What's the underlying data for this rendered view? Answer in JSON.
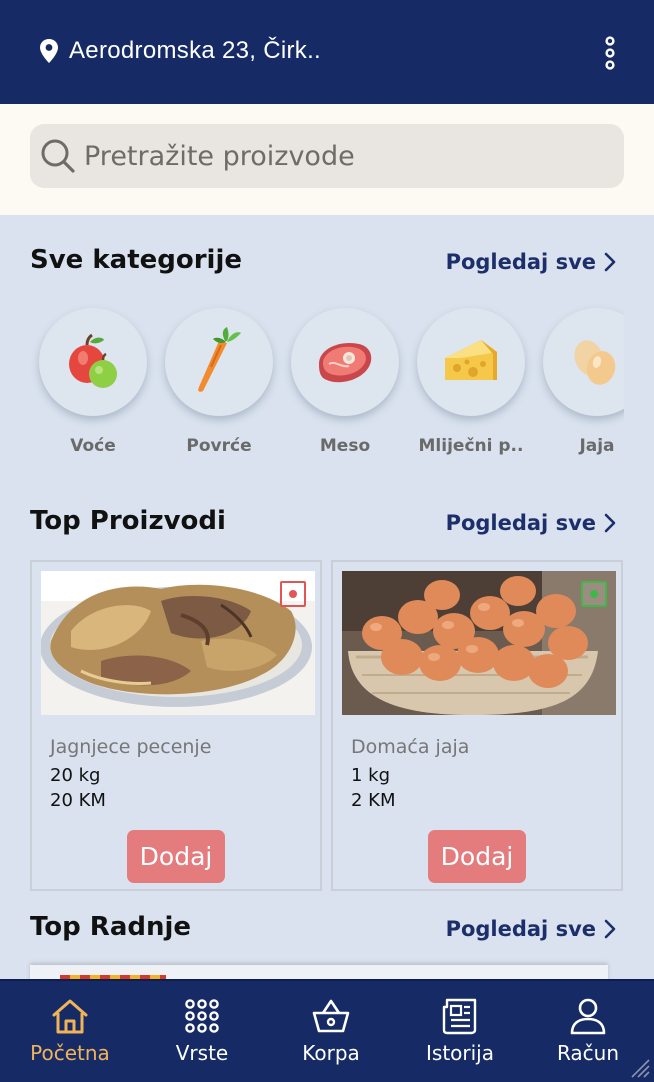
{
  "header": {
    "address": "Aerodromska 23, Čirk..",
    "icons": {
      "location": "location-pin-icon",
      "menu": "kebab-menu-icon"
    }
  },
  "search": {
    "placeholder": "Pretražite proizvode",
    "icon": "search-icon"
  },
  "categories_section": {
    "title": "Sve kategorije",
    "see_all": "Pogledaj sve",
    "items": [
      {
        "label": "Voće",
        "icon": "apple-icon"
      },
      {
        "label": "Povrće",
        "icon": "carrot-icon"
      },
      {
        "label": "Meso",
        "icon": "meat-icon"
      },
      {
        "label": "Mliječni p..",
        "icon": "cheese-icon"
      },
      {
        "label": "Jaja",
        "icon": "eggs-icon"
      }
    ]
  },
  "top_products": {
    "title": "Top Proizvodi",
    "see_all": "Pogledaj sve",
    "items": [
      {
        "name": "Jagnjece pecenje",
        "quantity": "20 kg",
        "price": "20 KM",
        "add_label": "Dodaj",
        "badge": "non-veg",
        "badge_color": "#e35555"
      },
      {
        "name": "Domaća jaja",
        "quantity": "1 kg",
        "price": "2 KM",
        "add_label": "Dodaj",
        "badge": "veg",
        "badge_color": "#3fb845"
      }
    ]
  },
  "top_shops": {
    "title": "Top Radnje",
    "see_all": "Pogledaj sve"
  },
  "nav": {
    "items": [
      {
        "label": "Početna",
        "icon": "home-icon",
        "active": true
      },
      {
        "label": "Vrste",
        "icon": "grid-dots-icon",
        "active": false
      },
      {
        "label": "Korpa",
        "icon": "basket-icon",
        "active": false
      },
      {
        "label": "Istorija",
        "icon": "newspaper-icon",
        "active": false
      },
      {
        "label": "Račun",
        "icon": "user-icon",
        "active": false
      }
    ]
  },
  "colors": {
    "brand_navy": "#162b66",
    "accent_orange": "#f0b35a",
    "button_red": "#e47b7d",
    "page_bg": "#d9e2ee"
  }
}
